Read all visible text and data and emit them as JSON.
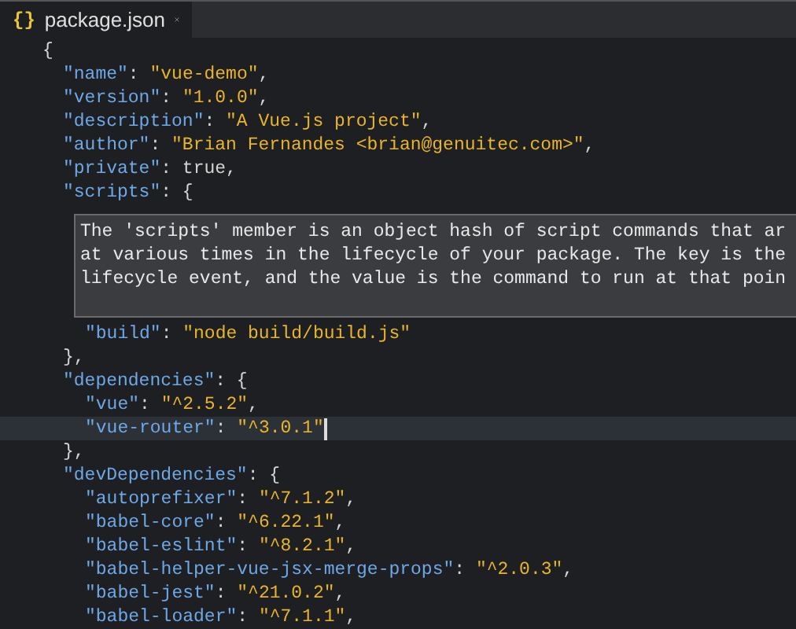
{
  "tab": {
    "icon": "{}",
    "label": "package.json",
    "selected": true
  },
  "lines": [
    {
      "tokens": [
        {
          "kind": "punct",
          "text": "{"
        }
      ],
      "children": [
        {
          "tokens": [
            {
              "kind": "key",
              "text": "\"name\""
            },
            {
              "kind": "punct",
              "text": ": "
            },
            {
              "kind": "string",
              "text": "\"vue-demo\""
            },
            {
              "kind": "punct",
              "text": ","
            }
          ]
        },
        {
          "tokens": [
            {
              "kind": "key",
              "text": "\"version\""
            },
            {
              "kind": "punct",
              "text": ": "
            },
            {
              "kind": "string",
              "text": "\"1.0.0\""
            },
            {
              "kind": "punct",
              "text": ","
            }
          ]
        },
        {
          "tokens": [
            {
              "kind": "key",
              "text": "\"description\""
            },
            {
              "kind": "punct",
              "text": ": "
            },
            {
              "kind": "string",
              "text": "\"A Vue.js project\""
            },
            {
              "kind": "punct",
              "text": ","
            }
          ]
        },
        {
          "tokens": [
            {
              "kind": "key",
              "text": "\"author\""
            },
            {
              "kind": "punct",
              "text": ": "
            },
            {
              "kind": "string",
              "text": "\"Brian Fernandes <brian@genuitec.com>\""
            },
            {
              "kind": "punct",
              "text": ","
            }
          ]
        },
        {
          "tokens": [
            {
              "kind": "key",
              "text": "\"private\""
            },
            {
              "kind": "punct",
              "text": ": true,"
            }
          ]
        },
        {
          "tokens": [
            {
              "kind": "key",
              "text": "\"scripts\""
            },
            {
              "kind": "punct",
              "text": ": {"
            }
          ],
          "tooltip": [
            "The 'scripts' member is an object hash of script commands that ar",
            "at various times in the lifecycle of your package. The key is the",
            "lifecycle event, and the value is the command to run at that poin"
          ],
          "children": [
            {
              "tokens": [
                {
                  "kind": "key",
                  "text": "\"build\""
                },
                {
                  "kind": "punct",
                  "text": ": "
                },
                {
                  "kind": "string",
                  "text": "\"node build/build.js\""
                }
              ]
            }
          ]
        },
        {
          "tokens": [
            {
              "kind": "punct",
              "text": "},"
            }
          ]
        },
        {
          "tokens": [
            {
              "kind": "key",
              "text": "\"dependencies\""
            },
            {
              "kind": "punct",
              "text": ": {"
            }
          ],
          "children": [
            {
              "tokens": [
                {
                  "kind": "key",
                  "text": "\"vue\""
                },
                {
                  "kind": "punct",
                  "text": ": "
                },
                {
                  "kind": "string",
                  "text": "\"^2.5.2\""
                },
                {
                  "kind": "punct",
                  "text": ","
                }
              ]
            },
            {
              "current": true,
              "tokens": [
                {
                  "kind": "key",
                  "text": "\"vue-router\""
                },
                {
                  "kind": "punct",
                  "text": ": "
                },
                {
                  "kind": "string",
                  "text": "\"^3.0.1\""
                }
              ]
            }
          ]
        },
        {
          "tokens": [
            {
              "kind": "punct",
              "text": "},"
            }
          ]
        },
        {
          "tokens": [
            {
              "kind": "key",
              "text": "\"devDependencies\""
            },
            {
              "kind": "punct",
              "text": ": {"
            }
          ],
          "children": [
            {
              "tokens": [
                {
                  "kind": "key",
                  "text": "\"autoprefixer\""
                },
                {
                  "kind": "punct",
                  "text": ": "
                },
                {
                  "kind": "string",
                  "text": "\"^7.1.2\""
                },
                {
                  "kind": "punct",
                  "text": ","
                }
              ]
            },
            {
              "tokens": [
                {
                  "kind": "key",
                  "text": "\"babel-core\""
                },
                {
                  "kind": "punct",
                  "text": ": "
                },
                {
                  "kind": "string",
                  "text": "\"^6.22.1\""
                },
                {
                  "kind": "punct",
                  "text": ","
                }
              ]
            },
            {
              "tokens": [
                {
                  "kind": "key",
                  "text": "\"babel-eslint\""
                },
                {
                  "kind": "punct",
                  "text": ": "
                },
                {
                  "kind": "string",
                  "text": "\"^8.2.1\""
                },
                {
                  "kind": "punct",
                  "text": ","
                }
              ]
            },
            {
              "tokens": [
                {
                  "kind": "key",
                  "text": "\"babel-helper-vue-jsx-merge-props\""
                },
                {
                  "kind": "punct",
                  "text": ": "
                },
                {
                  "kind": "string",
                  "text": "\"^2.0.3\""
                },
                {
                  "kind": "punct",
                  "text": ","
                }
              ]
            },
            {
              "tokens": [
                {
                  "kind": "key",
                  "text": "\"babel-jest\""
                },
                {
                  "kind": "punct",
                  "text": ": "
                },
                {
                  "kind": "string",
                  "text": "\"^21.0.2\""
                },
                {
                  "kind": "punct",
                  "text": ","
                }
              ]
            },
            {
              "tokens": [
                {
                  "kind": "key",
                  "text": "\"babel-loader\""
                },
                {
                  "kind": "punct",
                  "text": ": "
                },
                {
                  "kind": "string",
                  "text": "\"^7.1.1\""
                },
                {
                  "kind": "punct",
                  "text": ","
                }
              ]
            }
          ]
        }
      ]
    }
  ]
}
